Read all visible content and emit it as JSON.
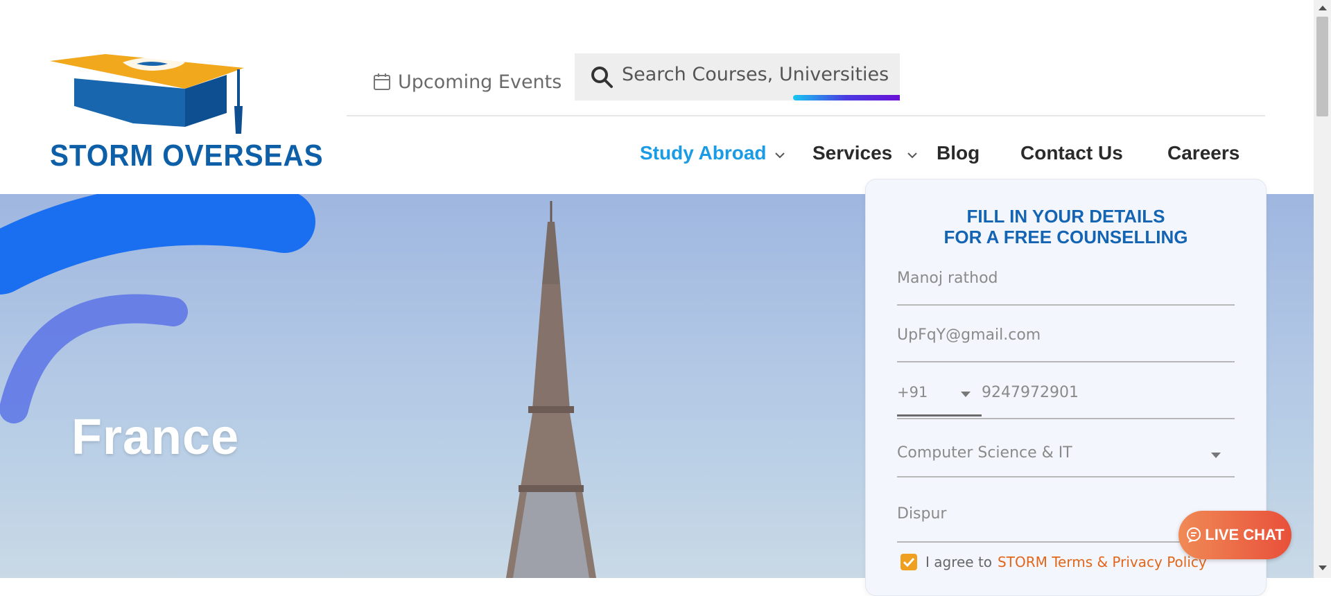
{
  "brand": {
    "name": "STORM OVERSEAS",
    "primary_color": "#0d5fa8",
    "accent_color": "#f0a020"
  },
  "header": {
    "upcoming_events": "Upcoming Events",
    "search_placeholder": "Search Courses, Universities",
    "nav": [
      {
        "label": "Study Abroad",
        "active": true,
        "has_dropdown": true
      },
      {
        "label": "Services",
        "active": false,
        "has_dropdown": true
      },
      {
        "label": "Blog",
        "active": false,
        "has_dropdown": false
      },
      {
        "label": "Contact Us",
        "active": false,
        "has_dropdown": false
      },
      {
        "label": "Careers",
        "active": false,
        "has_dropdown": false
      }
    ]
  },
  "hero": {
    "title": "France"
  },
  "form": {
    "title_line1": "FILL IN YOUR DETAILS",
    "title_line2": "FOR A FREE COUNSELLING",
    "name": "Manoj rathod",
    "email": "UpFqY@gmail.com",
    "phone_code": "+91",
    "phone": "9247972901",
    "course": "Computer Science & IT",
    "city": "Dispur",
    "agree_text": "I agree to",
    "agree_link": "STORM Terms & Privacy Policy",
    "agree_checked": true
  },
  "live_chat": {
    "label": "LIVE CHAT",
    "icon": "chat-bubble-icon"
  }
}
